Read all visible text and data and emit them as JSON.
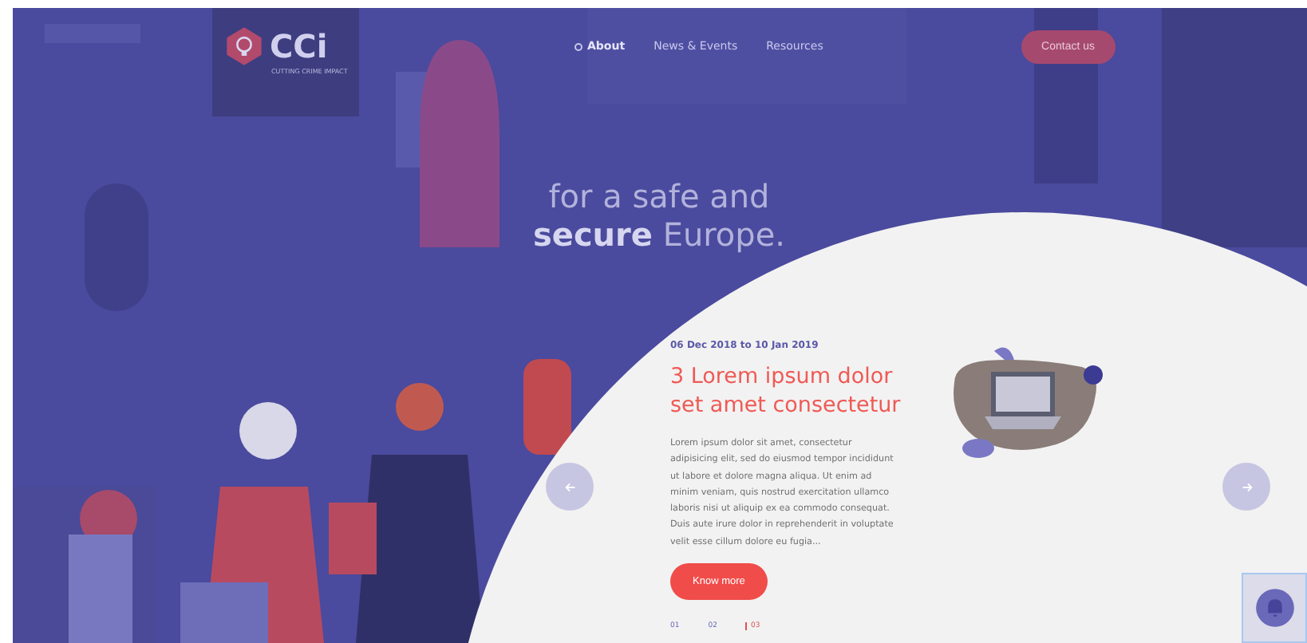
{
  "header": {
    "logo_text": "CCi",
    "logo_subtitle": "CUTTING CRIME IMPACT",
    "nav": [
      {
        "label": "About",
        "selected": true
      },
      {
        "label": "News & Events",
        "selected": false
      },
      {
        "label": "Resources",
        "selected": false
      }
    ],
    "cta": "Contact us"
  },
  "hero": {
    "tagline": "for a safe and **secure** Europe."
  },
  "event": {
    "date": "06 Dec 2018 to 10 Jan 2019",
    "title": "3 Lorem ipsum dolor set amet consectetur",
    "body": "Lorem ipsum dolor sit amet, consectetur adipisicing elit, sed do eiusmod tempor incididunt ut labore et dolore magna aliqua. Ut enim ad minim veniam, quis nostrud exercitation ullamco laboris nisi ut aliquip ex ea commodo consequat. Duis aute irure dolor in reprehenderit in voluptate velit esse cillum dolore eu fugia...",
    "button": "Know more"
  },
  "slides": [
    {
      "label": "01",
      "selected": false
    },
    {
      "label": "02",
      "selected": false
    },
    {
      "label": "03",
      "selected": true
    }
  ]
}
